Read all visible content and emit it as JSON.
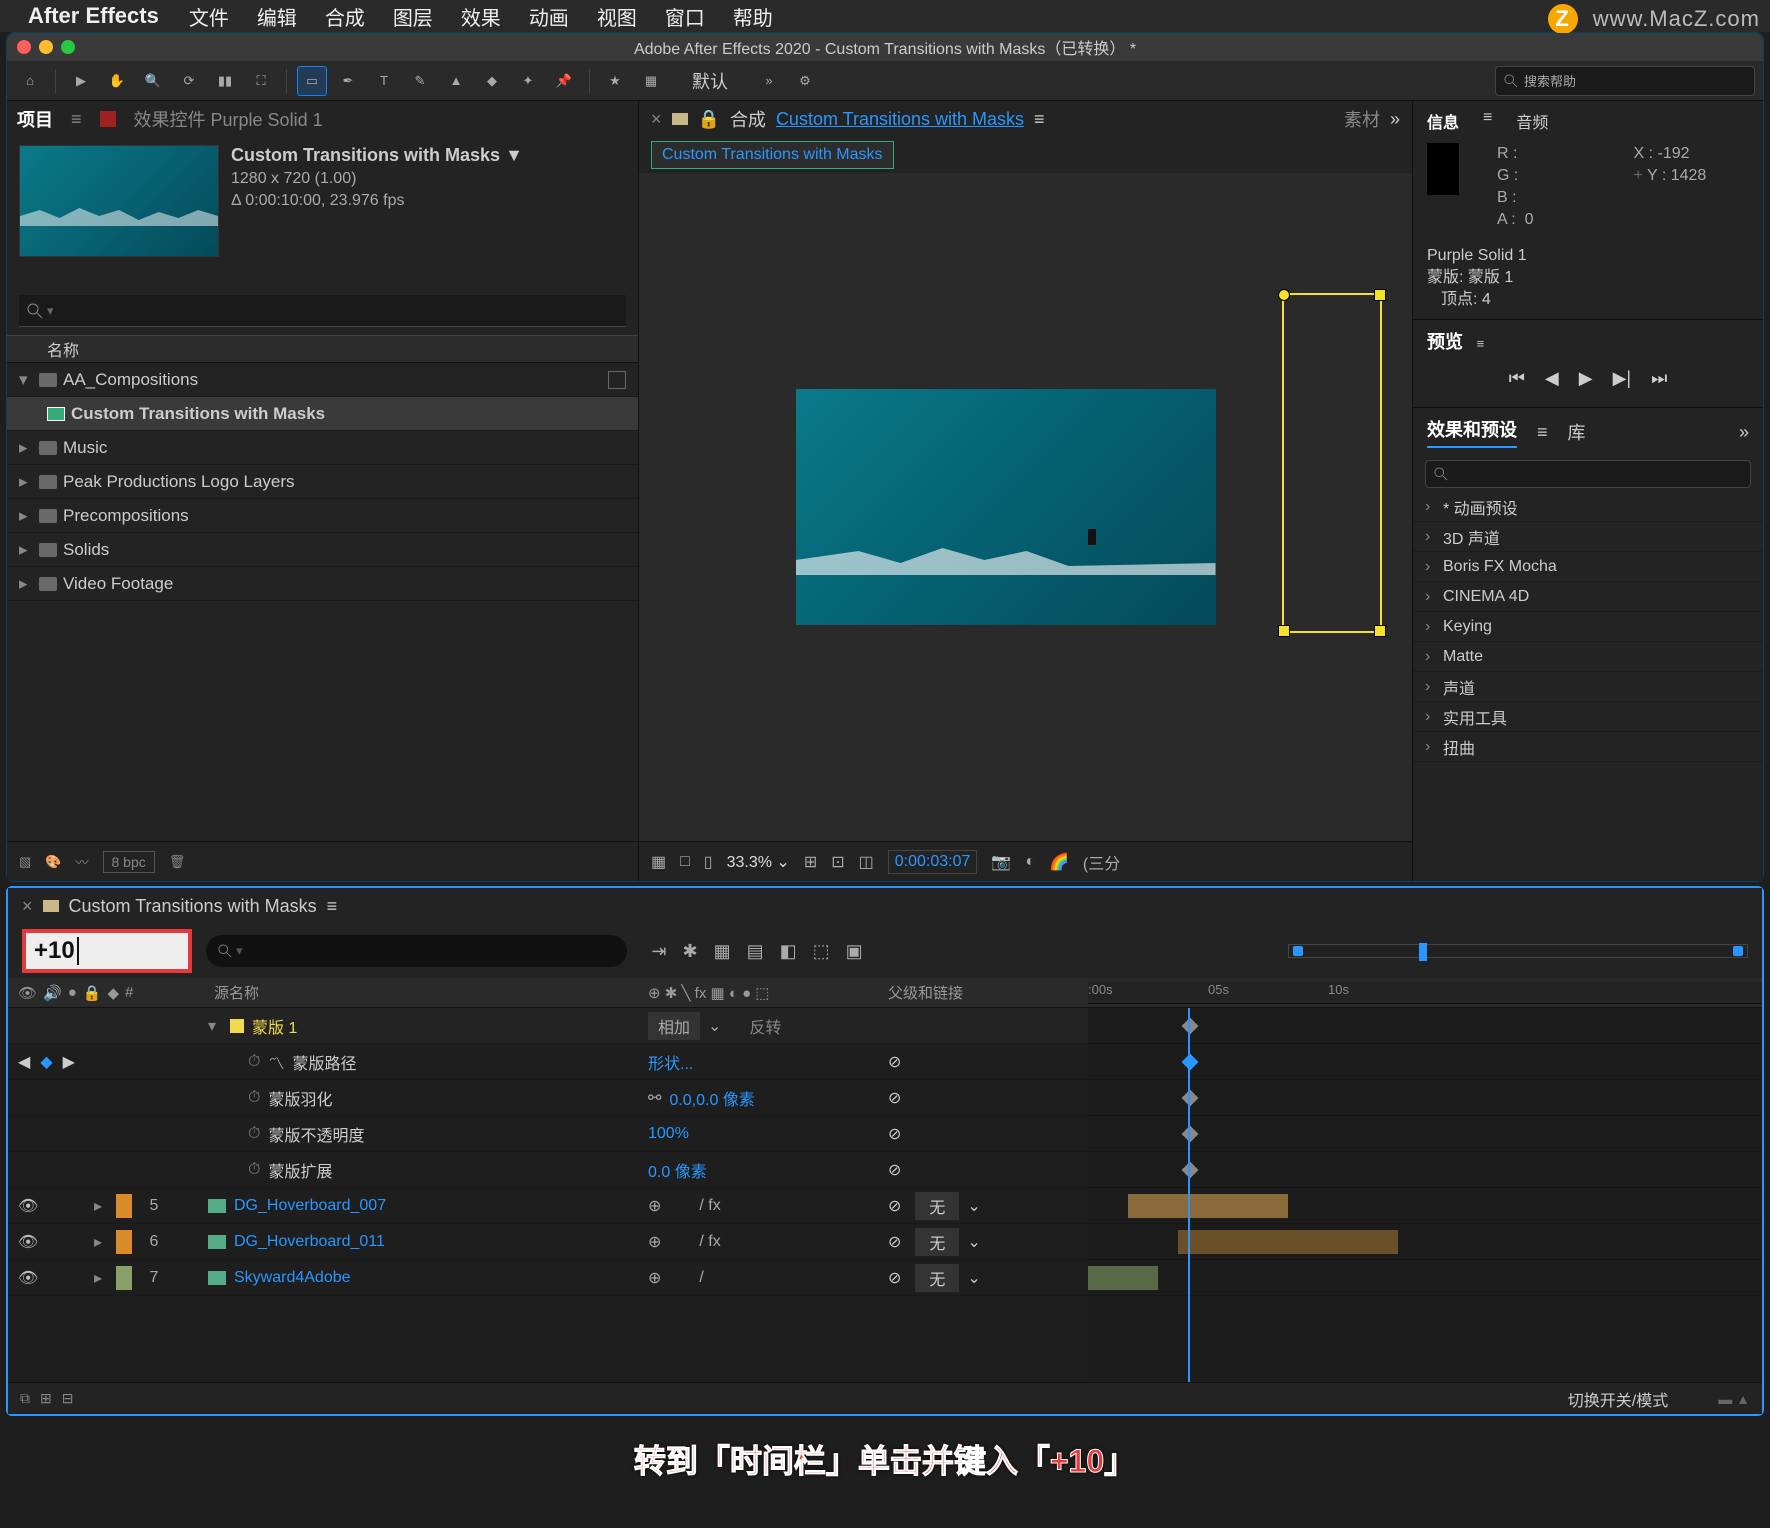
{
  "menubar": {
    "app": "After Effects",
    "items": [
      "文件",
      "编辑",
      "合成",
      "图层",
      "效果",
      "动画",
      "视图",
      "窗口",
      "帮助"
    ]
  },
  "watermark": {
    "z": "Z",
    "url": "www.MacZ.com"
  },
  "window_title": "Adobe After Effects 2020 - Custom Transitions with Masks（已转换） *",
  "toolbar": {
    "default_label": "默认",
    "search_placeholder": "搜索帮助"
  },
  "project": {
    "tab_project": "项目",
    "tab_effects": "效果控件 Purple Solid 1",
    "comp_name": "Custom Transitions with Masks",
    "comp_dims": "1280 x 720 (1.00)",
    "comp_dur": "Δ 0:00:10:00, 23.976 fps",
    "col_name": "名称",
    "tree": [
      {
        "label": "AA_Compositions",
        "type": "folder",
        "open": true
      },
      {
        "label": "Custom Transitions with Masks",
        "type": "comp",
        "indent": 1,
        "selected": true
      },
      {
        "label": "Music",
        "type": "folder"
      },
      {
        "label": "Peak Productions Logo Layers",
        "type": "folder"
      },
      {
        "label": "Precompositions",
        "type": "folder"
      },
      {
        "label": "Solids",
        "type": "folder"
      },
      {
        "label": "Video Footage",
        "type": "folder"
      }
    ],
    "bpc": "8 bpc"
  },
  "comp": {
    "tab_label": "合成",
    "comp_link": "Custom Transitions with Masks",
    "source_tab": "素材",
    "zoom": "33.3%",
    "time": "0:00:03:07",
    "footer_preset": "(三分"
  },
  "info": {
    "tab_info": "信息",
    "tab_audio": "音频",
    "r": "R :",
    "g": "G :",
    "b": "B :",
    "a": "A :",
    "a_val": "0",
    "x": "X : -192",
    "y": "Y : 1428",
    "sel_layer": "Purple Solid 1",
    "sel_mask": "蒙版: 蒙版 1",
    "sel_vert": "顶点: 4"
  },
  "preview": {
    "tab": "预览"
  },
  "effects": {
    "tab_fx": "效果和预设",
    "tab_lib": "库",
    "items": [
      "* 动画预设",
      "3D 声道",
      "Boris FX Mocha",
      "CINEMA 4D",
      "Keying",
      "Matte",
      "声道",
      "实用工具",
      "扭曲"
    ]
  },
  "timeline": {
    "tab_name": "Custom Transitions with Masks",
    "time_input": "+10",
    "col_num": "#",
    "col_source": "源名称",
    "col_parent": "父级和链接",
    "ruler": [
      ":00s",
      "05s",
      "10s"
    ],
    "mask": {
      "name": "蒙版 1",
      "mode": "相加",
      "invert": "反转",
      "path": {
        "label": "蒙版路径",
        "val": "形状..."
      },
      "feather": {
        "label": "蒙版羽化",
        "val": "0.0,0.0 像素"
      },
      "opacity": {
        "label": "蒙版不透明度",
        "val": "100%"
      },
      "expand": {
        "label": "蒙版扩展",
        "val": "0.0 像素"
      }
    },
    "layers": [
      {
        "n": "5",
        "name": "DG_Hoverboard_007",
        "parent": "无"
      },
      {
        "n": "6",
        "name": "DG_Hoverboard_011",
        "parent": "无"
      },
      {
        "n": "7",
        "name": "Skyward4Adobe",
        "parent": "无"
      }
    ],
    "switch_label": "切换开关/模式"
  },
  "caption": "转到「时间栏」单击并键入「+10」"
}
